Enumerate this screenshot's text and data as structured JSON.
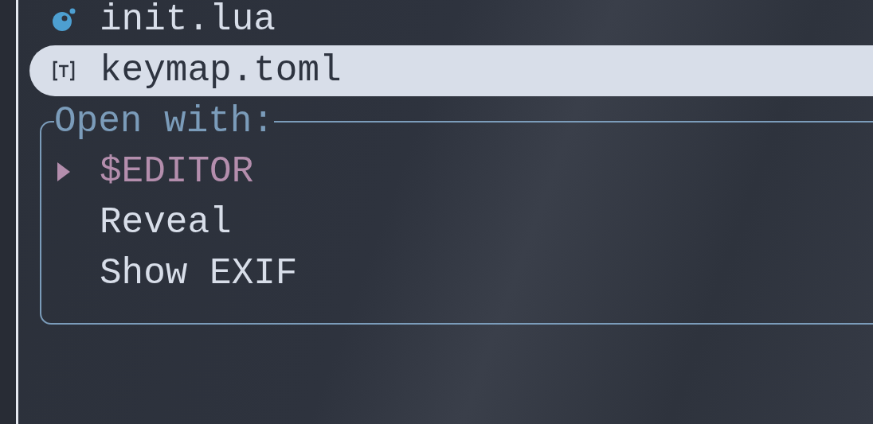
{
  "files": [
    {
      "name": "init.lua",
      "kind": "lua",
      "selected": false
    },
    {
      "name": "keymap.toml",
      "kind": "text",
      "selected": true
    }
  ],
  "open_with": {
    "title": "Open with:",
    "items": [
      {
        "label": "$EDITOR",
        "selected": true
      },
      {
        "label": "Reveal",
        "selected": false
      },
      {
        "label": "Show EXIF",
        "selected": false
      }
    ]
  }
}
